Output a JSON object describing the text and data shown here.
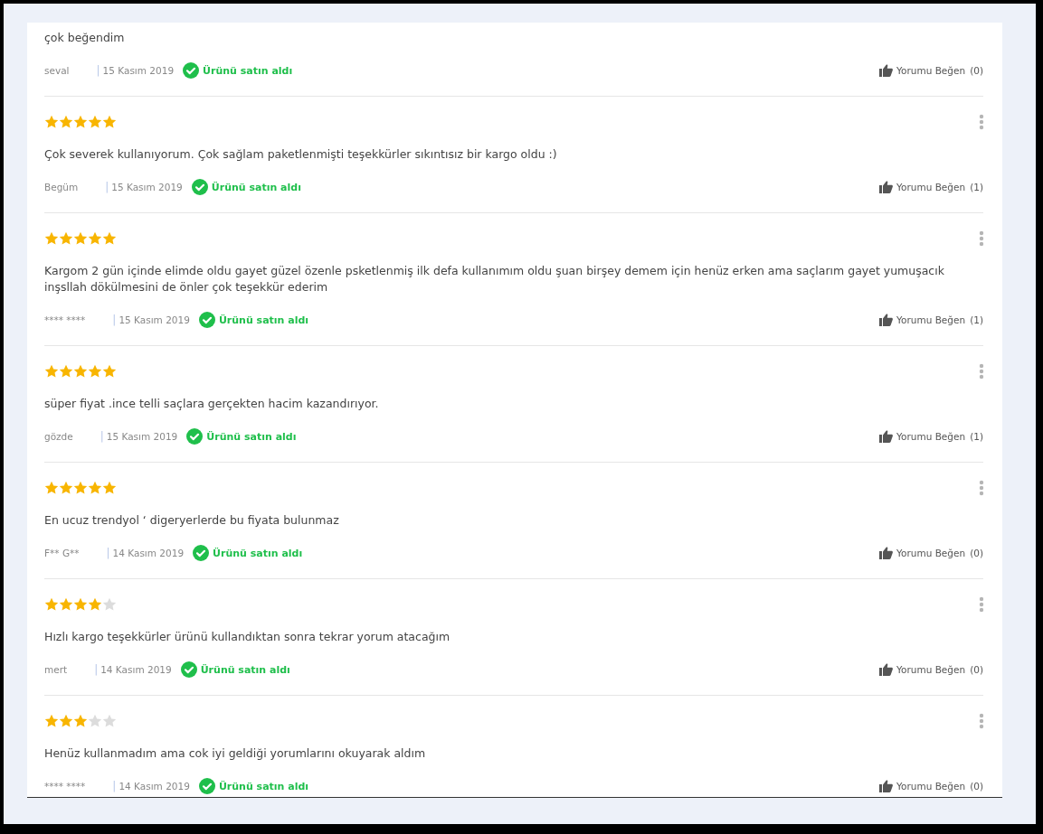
{
  "reviews": [
    {
      "text": "çok beğendim",
      "author": "seval",
      "separator": "|",
      "date": "15 Kasım 2019",
      "verified": "Ürünü satın aldı",
      "like_label": "Yorumu Beğen",
      "like_count": "(0)"
    },
    {
      "stars": 5,
      "text": "Çok severek kullanıyorum. Çok sağlam paketlenmişti teşekkürler sıkıntısız bir kargo oldu :)",
      "author": "Begüm",
      "separator": "|",
      "date": "15 Kasım 2019",
      "verified": "Ürünü satın aldı",
      "like_label": "Yorumu Beğen",
      "like_count": "(1)"
    },
    {
      "stars": 5,
      "text": "Kargom 2 gün içinde elimde oldu gayet güzel özenle psketlenmiş ilk defa kullanımım oldu şuan birşey demem için henüz erken ama saçlarım gayet yumuşacık inşsllah dökülmesini de önler çok teşekkür ederim",
      "author": "**** ****",
      "separator": "|",
      "date": "15 Kasım 2019",
      "verified": "Ürünü satın aldı",
      "like_label": "Yorumu Beğen",
      "like_count": "(1)"
    },
    {
      "stars": 5,
      "text": "süper fiyat .ince telli saçlara gerçekten hacim kazandırıyor.",
      "author": "gözde",
      "separator": "|",
      "date": "15 Kasım 2019",
      "verified": "Ürünü satın aldı",
      "like_label": "Yorumu Beğen",
      "like_count": "(1)"
    },
    {
      "stars": 5,
      "text": "En ucuz trendyol ‘ digeryerlerde bu fiyata bulunmaz",
      "author": "F** G**",
      "separator": "|",
      "date": "14 Kasım 2019",
      "verified": "Ürünü satın aldı",
      "like_label": "Yorumu Beğen",
      "like_count": "(0)"
    },
    {
      "stars": 4,
      "text": "Hızlı kargo teşekkürler ürünü kullandıktan sonra tekrar yorum atacağım",
      "author": "mert",
      "separator": "|",
      "date": "14 Kasım 2019",
      "verified": "Ürünü satın aldı",
      "like_label": "Yorumu Beğen",
      "like_count": "(0)"
    },
    {
      "stars": 3,
      "text": "Henüz kullanmadım ama cok iyi geldiği yorumlarını okuyarak aldım",
      "author": "**** ****",
      "separator": "|",
      "date": "14 Kasım 2019",
      "verified": "Ürünü satın aldı",
      "like_label": "Yorumu Beğen",
      "like_count": "(0)"
    }
  ]
}
